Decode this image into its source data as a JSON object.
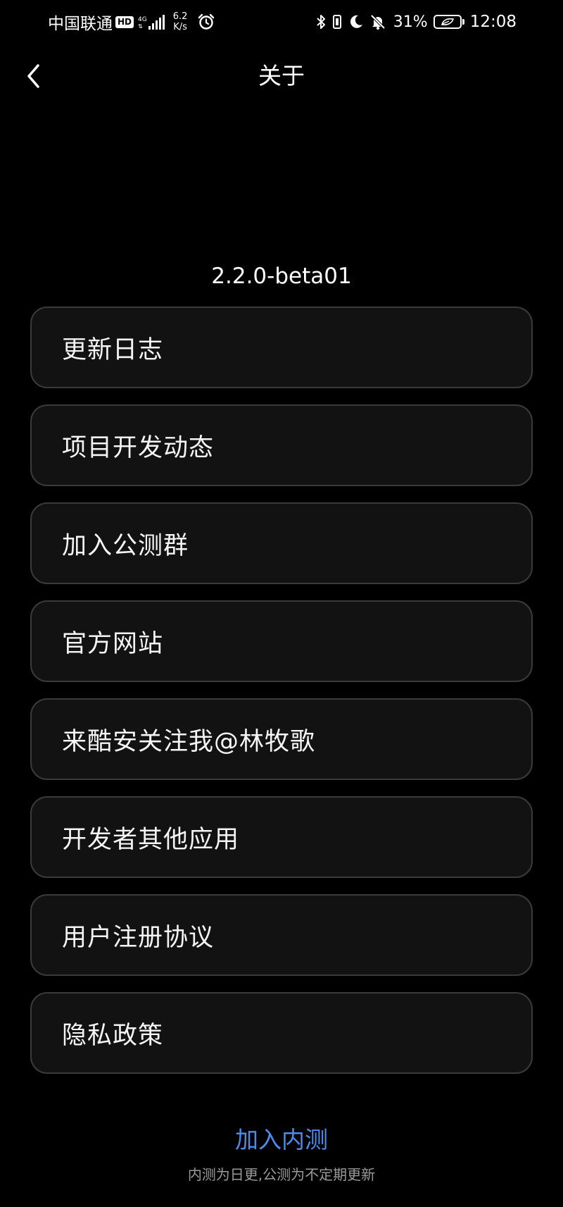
{
  "status_bar": {
    "carrier": "中国联通",
    "hd_badge": "HD",
    "network_type": "4G",
    "speed_value": "6.2",
    "speed_unit": "K/s",
    "battery_percent": "31%",
    "time": "12:08",
    "icons": [
      "hd-icon",
      "signal-icon",
      "alarm-icon",
      "bluetooth-icon",
      "vibrate-icon",
      "moon-icon",
      "bell-off-icon",
      "battery-icon"
    ]
  },
  "header": {
    "back_icon": "chevron-left-icon",
    "title": "关于"
  },
  "version": "2.2.0-beta01",
  "menu": [
    {
      "label": "更新日志"
    },
    {
      "label": "项目开发动态"
    },
    {
      "label": "加入公测群"
    },
    {
      "label": "官方网站"
    },
    {
      "label": "来酷安关注我@林牧歌"
    },
    {
      "label": "开发者其他应用"
    },
    {
      "label": "用户注册协议"
    },
    {
      "label": "隐私政策"
    }
  ],
  "footer": {
    "link": "加入内测",
    "note": "内测为日更,公测为不定期更新"
  },
  "colors": {
    "background": "#000000",
    "card": "#121212",
    "card_border": "#3a3a3a",
    "accent": "#4a8cf0"
  }
}
